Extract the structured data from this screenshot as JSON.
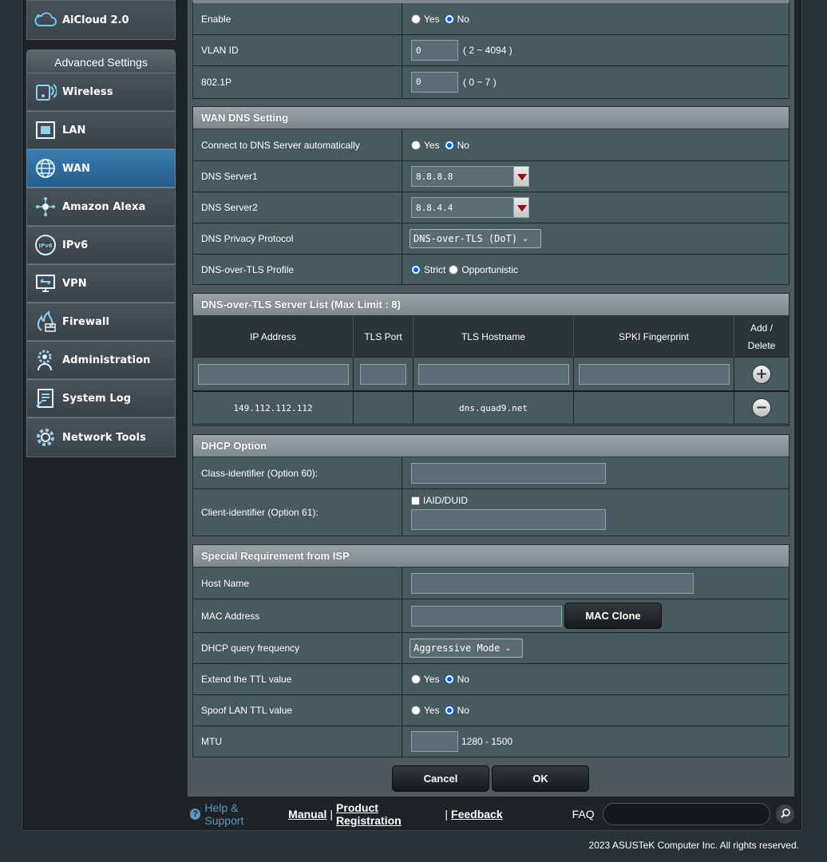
{
  "sidebar": {
    "top_item": {
      "label": "AiCloud 2.0",
      "icon": "cloud-icon"
    },
    "section_title": "Advanced Settings",
    "items": [
      {
        "label": "Wireless",
        "icon": "wireless-icon"
      },
      {
        "label": "LAN",
        "icon": "lan-icon"
      },
      {
        "label": "WAN",
        "icon": "globe-icon"
      },
      {
        "label": "Amazon Alexa",
        "icon": "alexa-icon"
      },
      {
        "label": "IPv6",
        "icon": "ipv6-icon"
      },
      {
        "label": "VPN",
        "icon": "vpn-icon"
      },
      {
        "label": "Firewall",
        "icon": "firewall-icon"
      },
      {
        "label": "Administration",
        "icon": "gear-person-icon"
      },
      {
        "label": "System Log",
        "icon": "system-log-icon"
      },
      {
        "label": "Network Tools",
        "icon": "gear-icon"
      }
    ],
    "active": "WAN"
  },
  "vlan": {
    "enable_label": "Enable",
    "yes": "Yes",
    "no": "No",
    "enable_selected": "No",
    "vlan_id_label": "VLAN ID",
    "vlan_id_value": "0",
    "vlan_id_hint": "( 2 ~ 4094 )",
    "p8021_label": "802.1P",
    "p8021_value": "0",
    "p8021_hint": "( 0 ~ 7 )"
  },
  "wan_dns": {
    "title": "WAN DNS Setting",
    "auto_label": "Connect to DNS Server automatically",
    "yes": "Yes",
    "no": "No",
    "auto_selected": "No",
    "dns1_label": "DNS Server1",
    "dns1_value": "8.8.8.8",
    "dns2_label": "DNS Server2",
    "dns2_value": "8.8.4.4",
    "privacy_label": "DNS Privacy Protocol",
    "privacy_value": "DNS-over-TLS (DoT)",
    "profile_label": "DNS-over-TLS Profile",
    "profile_strict": "Strict",
    "profile_opportunistic": "Opportunistic",
    "profile_selected": "Strict"
  },
  "dot_list": {
    "title": "DNS-over-TLS Server List (Max Limit : 8)",
    "headers": [
      "IP Address",
      "TLS Port",
      "TLS Hostname",
      "SPKI Fingerprint",
      "Add / Delete"
    ],
    "rows": [
      {
        "ip": "149.112.112.112",
        "port": "",
        "hostname": "dns.quad9.net",
        "spki": ""
      }
    ]
  },
  "dhcp_option": {
    "title": "DHCP Option",
    "class_label": "Class-identifier (Option 60):",
    "class_value": "",
    "client_label": "Client-identifier (Option 61):",
    "iaid_label": "IAID/DUID",
    "client_value": ""
  },
  "isp": {
    "title": "Special Requirement from ISP",
    "host_label": "Host Name",
    "host_value": "",
    "mac_label": "MAC Address",
    "mac_value": "",
    "mac_clone": "MAC Clone",
    "dhcp_freq_label": "DHCP query frequency",
    "dhcp_freq_value": "Aggressive Mode",
    "ttl_label": "Extend the TTL value",
    "spoof_label": "Spoof LAN TTL value",
    "yes": "Yes",
    "no": "No",
    "ttl_selected": "No",
    "spoof_selected": "No",
    "mtu_label": "MTU",
    "mtu_value": "",
    "mtu_hint": "1280 - 1500"
  },
  "actions": {
    "cancel": "Cancel",
    "ok": "OK"
  },
  "footer": {
    "help": "Help & Support",
    "manual": "Manual",
    "product_registration": "Product Registration",
    "feedback": "Feedback",
    "faq": "FAQ",
    "copyright": "2023 ASUSTeK Computer Inc. All rights reserved."
  }
}
